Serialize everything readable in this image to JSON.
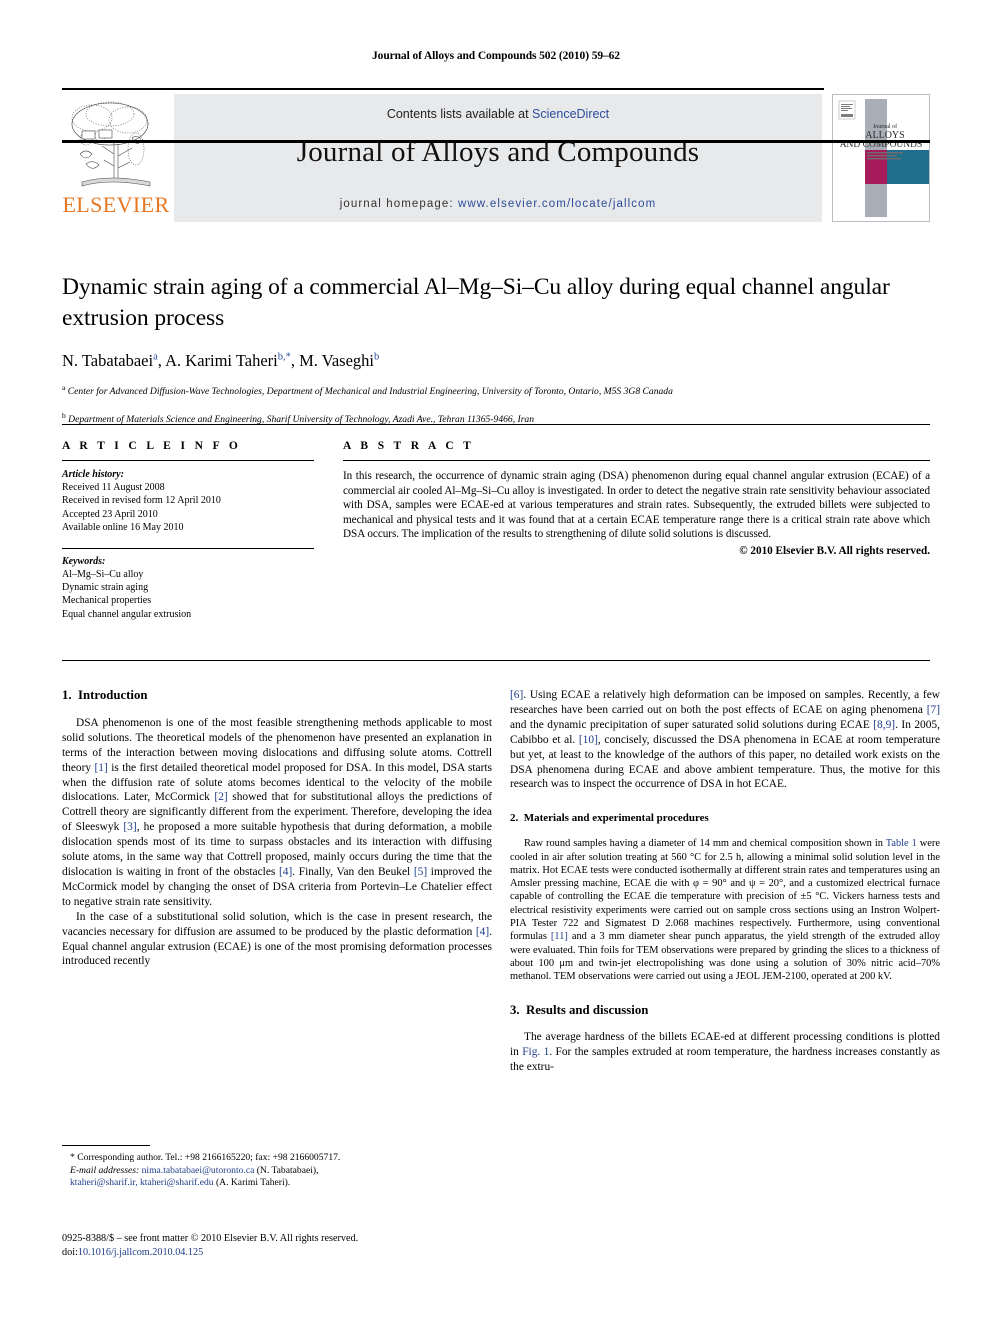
{
  "running_head": "Journal of Alloys and Compounds 502 (2010) 59–62",
  "masthead": {
    "contents_prefix": "Contents lists available at ",
    "sciencedirect": "ScienceDirect",
    "journal_title": "Journal of Alloys and Compounds",
    "homepage_prefix": "journal homepage: ",
    "homepage_url": "www.elsevier.com/locate/jallcom",
    "publisher_wordmark": "ELSEVIER",
    "cover": {
      "line1": "Journal of",
      "line2": "ALLOYS",
      "line3": "AND COMPOUNDS",
      "line4": "AN INTERNATIONAL JOURNAL OF MATERIALS SCIENCE AND",
      "line5": "SOLID STATE CHEMISTRY AND PHYSICS",
      "color_magenta": "#A61B5A",
      "color_teal": "#1F6E8C",
      "color_grey": "#A7AEB6"
    },
    "accent_orange": "#E87722",
    "link_blue": "#2B4C9B"
  },
  "title": "Dynamic strain aging of a commercial Al–Mg–Si–Cu alloy during equal channel angular extrusion process",
  "authors": [
    {
      "name": "N. Tabatabaei",
      "sup": "a"
    },
    {
      "name": "A. Karimi Taheri",
      "sup": "b,*"
    },
    {
      "name": "M. Vaseghi",
      "sup": "b"
    }
  ],
  "affiliations": [
    {
      "mark": "a",
      "text": "Center for Advanced Diffusion-Wave Technologies, Department of Mechanical and Industrial Engineering, University of Toronto, Ontario, M5S 3G8 Canada"
    },
    {
      "mark": "b",
      "text": "Department of Materials Science and Engineering, Sharif University of Technology, Azadi Ave., Tehran 11365-9466, Iran"
    }
  ],
  "article_info": {
    "heading": "A R T I C L E   I N F O",
    "history_label": "Article history:",
    "history": [
      "Received 11 August 2008",
      "Received in revised form 12 April 2010",
      "Accepted 23 April 2010",
      "Available online 16 May 2010"
    ],
    "keywords_label": "Keywords:",
    "keywords": [
      "Al–Mg–Si–Cu alloy",
      "Dynamic strain aging",
      "Mechanical properties",
      "Equal channel angular extrusion"
    ]
  },
  "abstract": {
    "heading": "A B S T R A C T",
    "text": "In this research, the occurrence of dynamic strain aging (DSA) phenomenon during equal channel angular extrusion (ECAE) of a commercial air cooled Al–Mg–Si–Cu alloy is investigated. In order to detect the negative strain rate sensitivity behaviour associated with DSA, samples were ECAE-ed at various temperatures and strain rates. Subsequently, the extruded billets were subjected to mechanical and physical tests and it was found that at a certain ECAE temperature range there is a critical strain rate above which DSA occurs. The implication of the results to strengthening of dilute solid solutions is discussed.",
    "copyright": "© 2010 Elsevier B.V. All rights reserved."
  },
  "sections": {
    "introduction": {
      "number": "1.",
      "heading": "Introduction",
      "p1_a": "DSA phenomenon is one of the most feasible strengthening methods applicable to most solid solutions. The theoretical models of the phenomenon have presented an explanation in terms of the interaction between moving dislocations and diffusing solute atoms. Cottrell theory ",
      "p1_r1": "[1]",
      "p1_b": " is the first detailed theoretical model proposed for DSA. In this model, DSA starts when the diffusion rate of solute atoms becomes identical to the velocity of the mobile dislocations. Later, McCormick ",
      "p1_r2": "[2]",
      "p1_c": " showed that for substitutional alloys the predictions of Cottrell theory are significantly different from the experiment. Therefore, developing the idea of Sleeswyk ",
      "p1_r3": "[3]",
      "p1_d": ", he proposed a more suitable hypothesis that during deformation, a mobile dislocation spends most of its time to surpass obstacles and its interaction with diffusing solute atoms, in the same way that Cottrell proposed, mainly occurs during the time that the dislocation is waiting in front of the obstacles ",
      "p1_r4": "[4]",
      "p1_e": ". Finally, Van den Beukel ",
      "p1_r5": "[5]",
      "p1_f": " improved the McCormick model by changing the onset of DSA criteria from Portevin–Le Chatelier effect to negative strain rate sensitivity.",
      "p2_a": "In the case of a substitutional solid solution, which is the case in present research, the vacancies necessary for diffusion are assumed to be produced by the plastic deformation ",
      "p2_r1": "[4]",
      "p2_b": ". Equal channel angular extrusion (ECAE) is one of the most promising deformation processes introduced recently ",
      "p2_r2": "[6]",
      "p2_c": ". Using ECAE a relatively high deformation can be imposed on samples. Recently, a few researches have been carried out on both the post effects of ECAE on aging phenomena ",
      "p2_r3": "[7]",
      "p2_d": " and the dynamic precipitation of super saturated solid solutions during ECAE ",
      "p2_r4": "[8,9]",
      "p2_e": ". In 2005, Cabibbo et al. ",
      "p2_r5": "[10]",
      "p2_f": ", concisely, discussed the DSA phenomena in ECAE at room temperature but yet, at least to the knowledge of the authors of this paper, no detailed work exists on the DSA phenomena during ECAE and above ambient temperature. Thus, the motive for this research was to inspect the occurrence of DSA in hot ECAE."
    },
    "materials": {
      "number": "2.",
      "heading": "Materials and experimental procedures",
      "p_a": "Raw round samples having a diameter of 14 mm and chemical composition shown in ",
      "table_link": "Table 1",
      "p_b": " were cooled in air after solution treating at 560 °C for 2.5 h, allowing a minimal solid solution level in the matrix. Hot ECAE tests were conducted isothermally at different strain rates and temperatures using an Amsler pressing machine, ECAE die with φ = 90° and ψ = 20°, and a customized electrical furnace capable of controlling the ECAE die temperature with precision of ±5 °C. Vickers harness tests and electrical resistivity experiments were carried out on sample cross sections using an Instron Wolpert-PIA Tester 722 and Sigmatest D 2.068 machines respectively. Furthermore, using conventional formulas ",
      "p_r1": "[11]",
      "p_c": " and a 3 mm diameter shear punch apparatus, the yield strength of the extruded alloy were evaluated. Thin foils for TEM observations were prepared by grinding the slices to a thickness of about 100 μm and twin-jet electropolishing was done using a solution of 30% nitric acid–70% methanol. TEM observations were carried out using a JEOL JEM-2100, operated at 200 kV."
    },
    "results": {
      "number": "3.",
      "heading": "Results and discussion",
      "p_a": "The average hardness of the billets ECAE-ed at different processing conditions is plotted in ",
      "fig_link": "Fig. 1",
      "p_b": ". For the samples extruded at room temperature, the hardness increases constantly as the extru-"
    }
  },
  "footnote": {
    "corresponding": "* Corresponding author. Tel.: +98 2166165220; fax: +98 2166005717.",
    "email_label": "E-mail addresses:",
    "email1": "nima.tabatabaei@utoronto.ca",
    "email1_owner": " (N. Tabatabaei),",
    "email2": "ktaheri@sharif.ir, ktaheri@sharif.edu",
    "email2_owner": " (A. Karimi Taheri)."
  },
  "footer": {
    "issn_line": "0925-8388/$ – see front matter © 2010 Elsevier B.V. All rights reserved.",
    "doi_label": "doi:",
    "doi_value": "10.1016/j.jallcom.2010.04.125"
  }
}
